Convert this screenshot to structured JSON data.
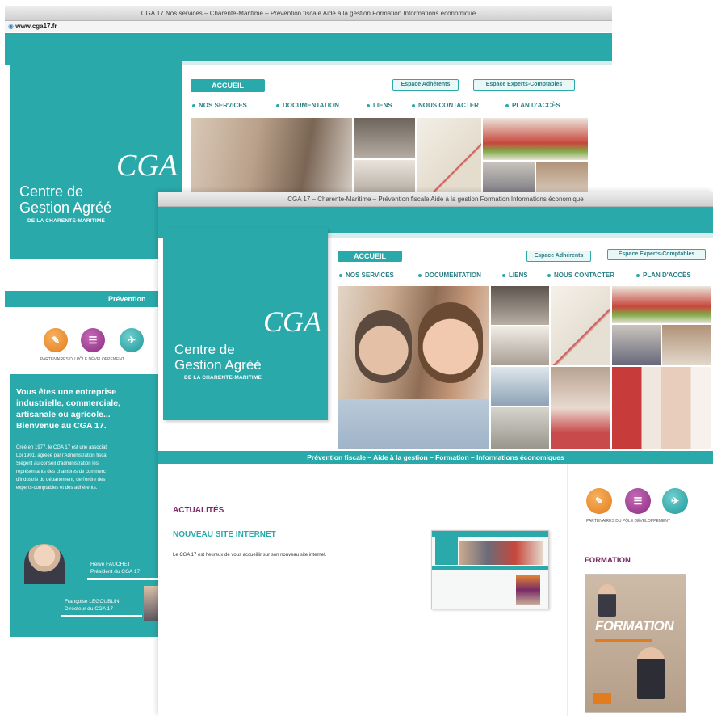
{
  "back_window": {
    "title": "CGA 17 Nos services – Charente-Maritime – Prévention fiscale Aide à la gestion Formation Informations économique",
    "url": "www.cga17.fr",
    "logo": {
      "line1": "Centre de",
      "line2": "Gestion Agréé",
      "sub": "DE LA CHARENTE-MARITIME",
      "mark": "CGA"
    },
    "menu": {
      "home": "ACCUEIL",
      "items": [
        "NOS SERVICES",
        "DOCUMENTATION",
        "LIENS",
        "NOUS CONTACTER",
        "PLAN D'ACCÈS"
      ]
    },
    "buttons": {
      "adherents": "Espace Adhérents",
      "experts": "Espace Experts-Comptables"
    },
    "tagline": "Prévention",
    "icons_label": "PARTENAIRES DU PÔLE DÉVELOPPEMENT",
    "welcome": {
      "heading_lines": [
        "Vous êtes une entreprise",
        "industrielle, commerciale,",
        "artisanale ou agricole...",
        "Bienvenue au CGA 17."
      ],
      "body_lines": [
        "Créé en 1977, le CGA 17 est une associat",
        "Loi 1901, agréée par l'Administration fisca",
        "Siègent au conseil d'administration les",
        "représentants des chambres de commerc",
        "d'industrie du département, de l'ordre des",
        "experts-comptables et des adhérents."
      ]
    },
    "people": [
      {
        "name": "Hervé FAUCHET",
        "role": "Président du CGA 17"
      },
      {
        "name": "Françoise LEGOUBLIN",
        "role": "Directeur du CGA 17"
      }
    ]
  },
  "front_window": {
    "title": "CGA 17 – Charente-Maritime – Prévention fiscale Aide à la gestion Formation Informations économique",
    "logo": {
      "line1": "Centre de",
      "line2": "Gestion Agréé",
      "sub": "DE LA CHARENTE-MARITIME",
      "mark": "CGA"
    },
    "menu": {
      "home": "ACCUEIL",
      "items": [
        "NOS SERVICES",
        "DOCUMENTATION",
        "LIENS",
        "NOUS CONTACTER",
        "PLAN D'ACCÈS"
      ]
    },
    "buttons": {
      "adherents": "Espace Adhérents",
      "experts": "Espace Experts-Comptables"
    },
    "tagline": "Prévention fiscale – Aide à la gestion – Formation – Informations économiques",
    "news": {
      "section": "ACTUALITÉS",
      "headline": "NOUVEAU SITE INTERNET",
      "text": "Le CGA 17 est heureux de vous accueillir sur son nouveau site internet."
    },
    "icons_label": "PARTENAIRES DU PÔLE DÉVELOPPEMENT",
    "formation": {
      "section": "FORMATION",
      "poster_title": "FORMATION"
    }
  },
  "colors": {
    "teal": "#2aa9ab",
    "plum": "#7a2a66"
  }
}
